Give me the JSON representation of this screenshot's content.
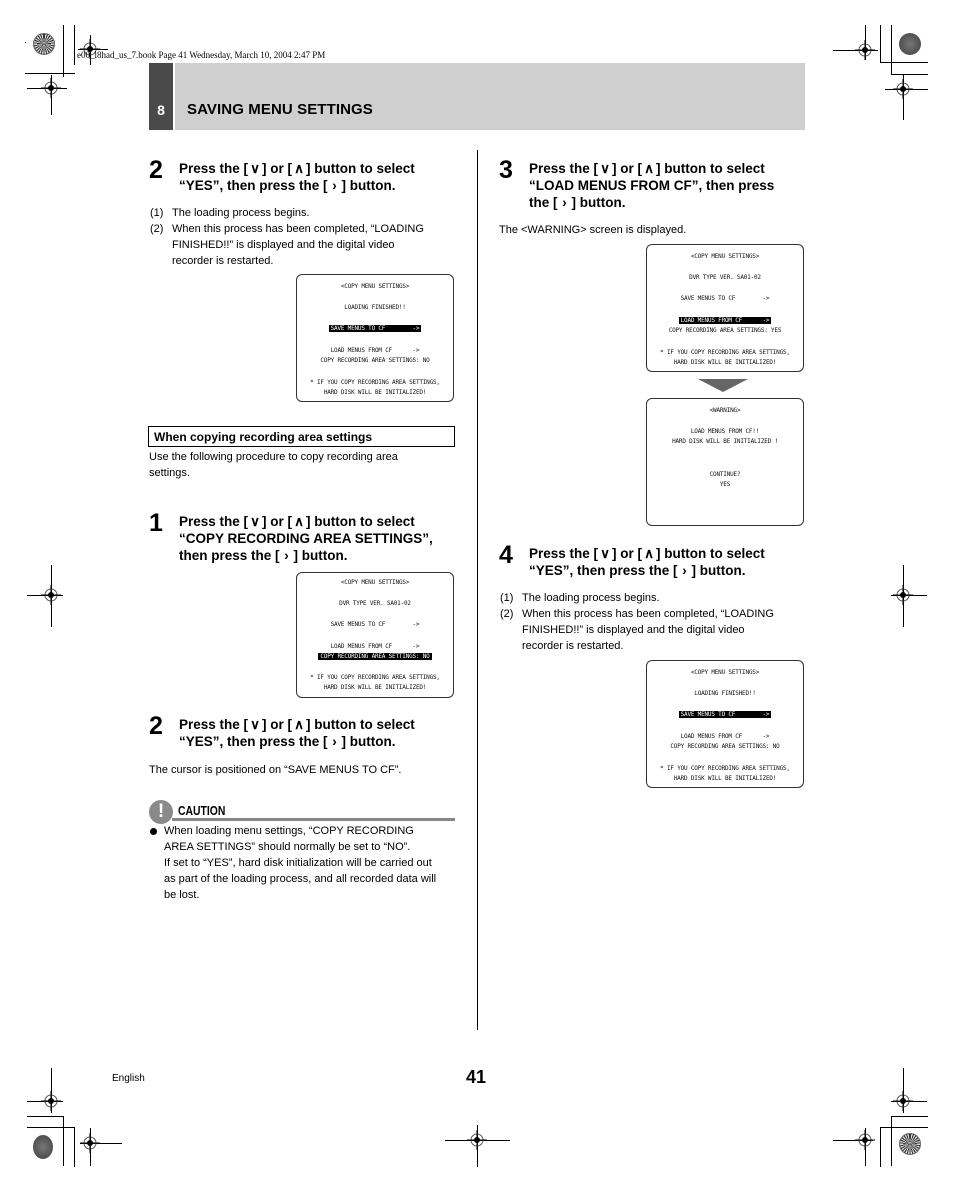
{
  "print_slug": "e00_l8had_us_7.book  Page 41  Wednesday, March 10, 2004  2:47 PM",
  "header": {
    "chapter_number": "8",
    "title": "SAVING MENU SETTINGS"
  },
  "glyphs": {
    "down": "∨",
    "up": "∧",
    "right": "›"
  },
  "left_column": {
    "step2a": {
      "number": "2",
      "line1_pre": "Press the [",
      "line1_mid": "] or [",
      "line1_post": "] button to select",
      "line2_pre": "“YES”, then press the [",
      "line2_post": "] button.",
      "notes": [
        {
          "n": "(1)",
          "text": [
            "The loading process begins."
          ]
        },
        {
          "n": "(2)",
          "text": [
            "When this process has been completed, “LOADING",
            "FINISHED!!” is displayed and the digital video",
            "recorder is restarted."
          ]
        }
      ],
      "screen": {
        "lines": [
          "<COPY MENU SETTINGS>",
          "LOADING FINISHED!!",
          "SAVE MENUS TO CF        ->",
          "LOAD MENUS FROM CF      ->",
          "COPY RECORDING AREA SETTINGS: NO",
          "* IF YOU COPY RECORDING AREA SETTINGS,",
          "HARD DISK WILL BE INITIALIZED!"
        ],
        "highlighted_line": 2
      }
    },
    "section": {
      "title": "When copying recording area settings",
      "intro": [
        "Use the following procedure to copy recording area",
        "settings."
      ]
    },
    "step1": {
      "number": "1",
      "line1_pre": "Press the [",
      "line1_mid": "] or [",
      "line1_post": "] button to select",
      "line2": "“COPY RECORDING AREA SETTINGS”,",
      "line3_pre": "then press the [",
      "line3_post": "] button.",
      "screen": {
        "lines": [
          "<COPY MENU SETTINGS>",
          "DVR TYPE VER. SA01-02",
          "SAVE MENUS TO CF        ->",
          "LOAD MENUS FROM CF      ->",
          "COPY RECORDING AREA SETTINGS: NO",
          "* IF YOU COPY RECORDING AREA SETTINGS,",
          "HARD DISK WILL BE INITIALIZED!"
        ],
        "highlighted_line": 4
      }
    },
    "step2b": {
      "number": "2",
      "line1_pre": "Press the [",
      "line1_mid": "] or [",
      "line1_post": "] button to select",
      "line2_pre": "“YES”, then press the [",
      "line2_post": "] button.",
      "note": "The cursor is positioned on “SAVE MENUS TO CF”."
    },
    "caution": {
      "icon": "!",
      "label": "CAUTION",
      "lines": [
        "When loading menu settings, “COPY RECORDING",
        "AREA SETTINGS” should normally be set to “NO”.",
        "If set to “YES”, hard disk initialization will be carried out",
        "as part of the loading process, and all recorded data will",
        "be lost."
      ]
    }
  },
  "right_column": {
    "step3": {
      "number": "3",
      "line1_pre": "Press the [",
      "line1_mid": "] or [",
      "line1_post": "] button to select",
      "line2": "“LOAD MENUS FROM CF”, then press",
      "line3_pre": "the [",
      "line3_post": "] button.",
      "note": "The <WARNING> screen is displayed.",
      "screen1": {
        "lines": [
          "<COPY MENU SETTINGS>",
          "DVR TYPE VER. SA01-02",
          "SAVE MENUS TO CF        ->",
          "LOAD MENUS FROM CF      ->",
          "COPY RECORDING AREA SETTINGS: YES",
          "* IF YOU COPY RECORDING AREA SETTINGS,",
          "HARD DISK WILL BE INITIALIZED!"
        ],
        "highlighted_line": 3
      },
      "screen2": {
        "lines": [
          "<WARNING>",
          "LOAD MENUS FROM CF!!",
          "HARD DISK WILL BE INITIALIZED !",
          "CONTINUE?",
          "YES"
        ]
      }
    },
    "step4": {
      "number": "4",
      "line1_pre": "Press the [",
      "line1_mid": "] or [",
      "line1_post": "] button to select",
      "line2_pre": "“YES”, then press the [",
      "line2_post": "] button.",
      "notes": [
        {
          "n": "(1)",
          "text": [
            "The loading process begins."
          ]
        },
        {
          "n": "(2)",
          "text": [
            "When this process has been completed, “LOADING",
            "FINISHED!!” is displayed and the digital video",
            "recorder is restarted."
          ]
        }
      ],
      "screen": {
        "lines": [
          "<COPY MENU SETTINGS>",
          "LOADING FINISHED!!",
          "SAVE MENUS TO CF        ->",
          "LOAD MENUS FROM CF      ->",
          "COPY RECORDING AREA SETTINGS: NO",
          "* IF YOU COPY RECORDING AREA SETTINGS,",
          "HARD DISK WILL BE INITIALIZED!"
        ],
        "highlighted_line": 2
      }
    }
  },
  "footer": {
    "language": "English",
    "page_number": "41"
  }
}
